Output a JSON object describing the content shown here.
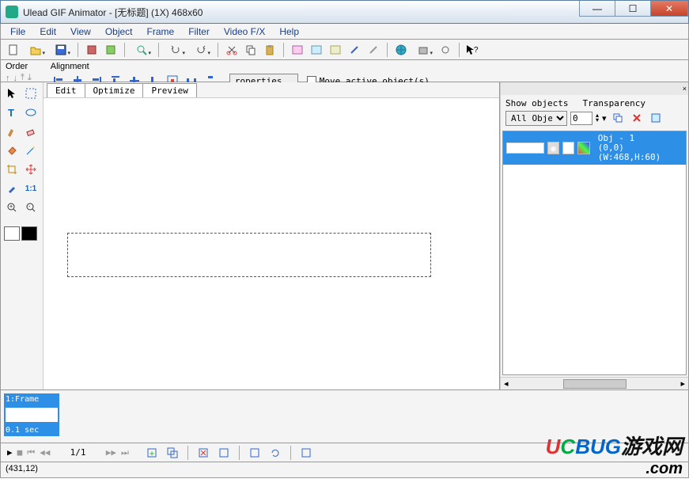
{
  "title": "Ulead GIF Animator - [无标题] (1X) 468x60",
  "menu": [
    "File",
    "Edit",
    "View",
    "Object",
    "Frame",
    "Filter",
    "Video F/X",
    "Help"
  ],
  "secondbar": {
    "order_label": "Order",
    "align_label": "Alignment",
    "properties_btn": "roperties..",
    "move_active_label": "Move active object(s)"
  },
  "tabs": {
    "edit": "Edit",
    "optimize": "Optimize",
    "preview": "Preview"
  },
  "panel": {
    "show_label": "Show objects",
    "transparency_label": "Transparency",
    "selector_value": "All Object:",
    "transparency_value": "0",
    "object_name": "Obj - 1",
    "object_dims": "(0,0)(W:468,H:60)"
  },
  "frame": {
    "label": "1:Frame",
    "duration": "0.1 sec"
  },
  "playbar": {
    "position": "1/1"
  },
  "status": "(431,12)",
  "watermark": {
    "brand_u": "U",
    "brand_c": "C",
    "brand_b": "BUG",
    "brand_rest": "游戏网",
    "com": ".com"
  }
}
